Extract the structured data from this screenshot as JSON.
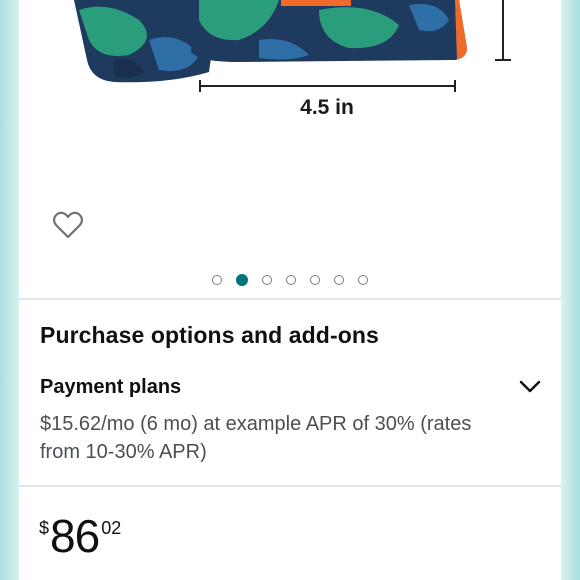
{
  "product": {
    "image_alt": "Product image",
    "dimension_label": "4.5 in"
  },
  "carousel": {
    "total": 7,
    "active_index": 1
  },
  "purchase": {
    "section_title": "Purchase options and add-ons",
    "payment_plans_title": "Payment plans",
    "payment_plans_desc": "$15.62/mo (6 mo) at example APR of 30% (rates from 10-30% APR)"
  },
  "price": {
    "symbol": "$",
    "whole": "86",
    "fraction": "02"
  },
  "icons": {
    "wishlist": "heart-outline-icon",
    "expand": "chevron-down-icon"
  },
  "colors": {
    "accent_teal": "#00747b",
    "page_background": "#d8f0ef",
    "text": "#0f1111"
  }
}
